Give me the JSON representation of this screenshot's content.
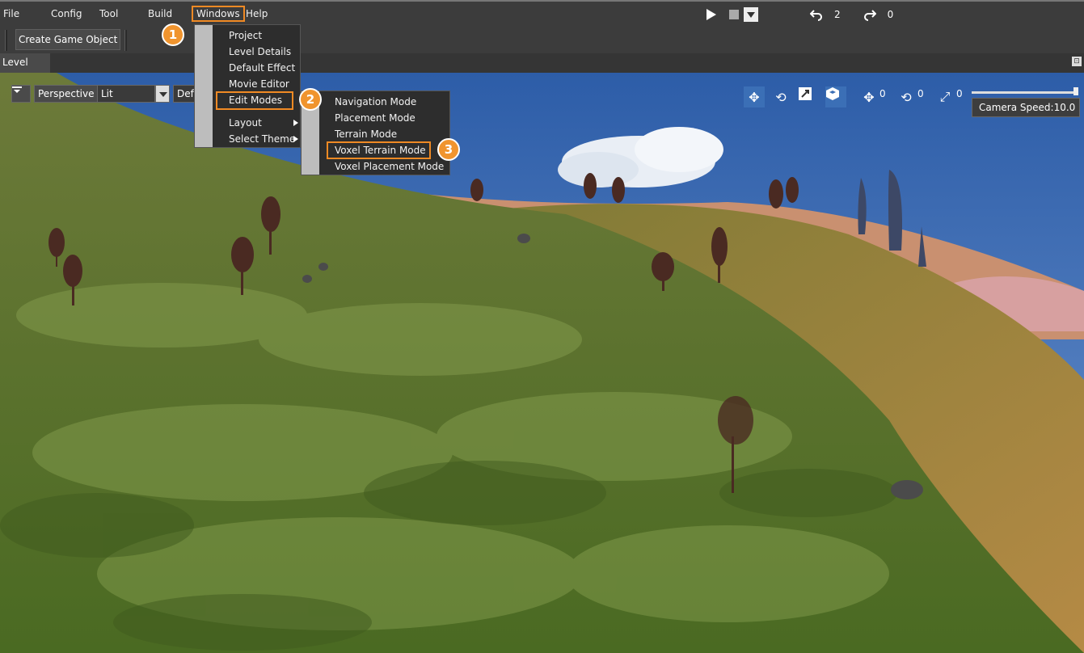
{
  "menubar": {
    "items": [
      "File",
      "Config",
      "Tool",
      "Build",
      "Windows",
      "Help"
    ]
  },
  "playback": {
    "play_icon": "play-icon",
    "stop_icon": "stop-icon",
    "dropdown_icon": "chevron-down-icon",
    "undo_icon": "undo-icon",
    "undo_count": "2",
    "redo_icon": "redo-icon",
    "redo_count": "0"
  },
  "toolbar": {
    "create_game_object_label": "Create Game Object"
  },
  "tabs": {
    "level_label": "Level"
  },
  "viewport": {
    "view_mode": "Perspective",
    "lighting_mode": "Lit",
    "third_select_value": "Defa",
    "gizmo_translate_value": "0",
    "gizmo_rotate_value": "0",
    "gizmo_scale_value": "0",
    "camera_speed_label": "Camera Speed:10.0"
  },
  "windows_menu": {
    "items": [
      "Project",
      "Level Details",
      "Default Effect",
      "Movie Editor",
      "Edit Modes",
      "Layout",
      "Select Theme"
    ]
  },
  "edit_modes_menu": {
    "items": [
      "Navigation Mode",
      "Placement Mode",
      "Terrain Mode",
      "Voxel Terrain Mode",
      "Voxel Placement Mode"
    ]
  },
  "callouts": [
    "1",
    "2",
    "3"
  ],
  "colors": {
    "highlight": "#f08a24",
    "callout": "#f0942e",
    "active_gizmo": "#3b6fb6"
  }
}
